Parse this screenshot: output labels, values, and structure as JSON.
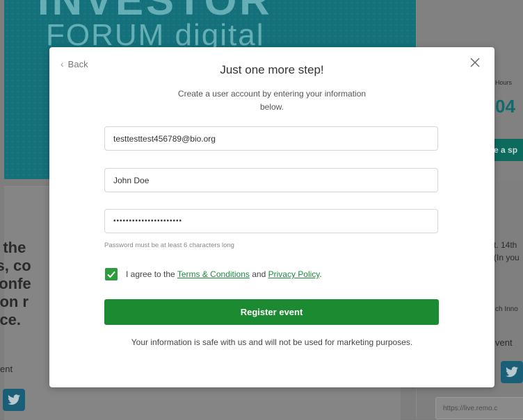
{
  "background": {
    "hero_line1": "INVESTOR",
    "hero_line2": "FORUM digital",
    "left_text_lines": [
      "e the",
      "rs, co",
      "confe",
      "tion r",
      "nce."
    ],
    "left_small": "ent",
    "right_hours_label": "Hours",
    "right_hours_value": "04",
    "right_button": "e a sp",
    "right_text_lines": [
      "t. 14th",
      "(In you"
    ],
    "right_text2": "ch Inno",
    "right_text3": "vent",
    "right_link_input": "https://live.remo.c"
  },
  "modal": {
    "back_label": "Back",
    "title": "Just one more step!",
    "subtitle": "Create a user account by entering your information below.",
    "email_value": "testtesttest456789@bio.org",
    "name_value": "John Doe",
    "password_masked": "••••••••••••••••••••••",
    "password_hint": "Password must be at least 6 characters long",
    "agree_prefix": "I agree to the",
    "terms_link": "Terms & Conditions",
    "agree_and": "and",
    "privacy_link": "Privacy Policy",
    "agree_suffix": ".",
    "register_label": "Register event",
    "safe_note": "Your information is safe with us and will not be used for marketing purposes."
  },
  "colors": {
    "overlay": "#7e7e7e",
    "accent_green": "#1c8a31",
    "link_green": "#1d8a3e",
    "hero_teal": "#14707a"
  }
}
